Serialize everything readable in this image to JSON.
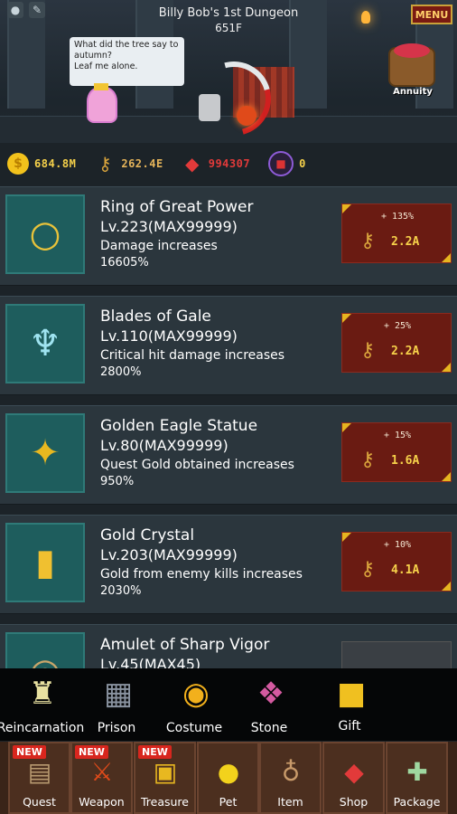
{
  "scene": {
    "title": "Billy Bob's 1st Dungeon",
    "floor": "651F",
    "menu_label": "MENU",
    "speech_lines": [
      "What did the tree say to",
      "autumn?",
      "Leaf me alone."
    ],
    "annuity_label": "Annuity",
    "top_icons": [
      "coin-pile-icon",
      "wrench-icon"
    ]
  },
  "currency": {
    "gold": "684.8M",
    "keys": "262.4E",
    "gems": "994307",
    "stones": "0"
  },
  "items": [
    {
      "name": "Ring of Great Power",
      "level": "Lv.223(MAX99999)",
      "desc": "Damage increases",
      "value": "16605%",
      "upgrade_pct": "+ 135%",
      "cost": "2.2A",
      "icon": "ring-icon"
    },
    {
      "name": "Blades of Gale",
      "level": "Lv.110(MAX99999)",
      "desc": "Critical hit damage increases",
      "value": "2800%",
      "upgrade_pct": "+ 25%",
      "cost": "2.2A",
      "icon": "blade-icon"
    },
    {
      "name": "Golden Eagle Statue",
      "level": "Lv.80(MAX99999)",
      "desc": "Quest Gold obtained increases",
      "value": "950%",
      "upgrade_pct": "+ 15%",
      "cost": "1.6A",
      "icon": "eagle-icon"
    },
    {
      "name": "Gold Crystal",
      "level": "Lv.203(MAX99999)",
      "desc": "Gold from enemy kills increases",
      "value": "2030%",
      "upgrade_pct": "+ 10%",
      "cost": "4.1A",
      "icon": "crystal-icon"
    },
    {
      "name": "Amulet of Sharp Vigor",
      "level": "Lv.45(MAX45)",
      "icon": "amulet-icon"
    }
  ],
  "mid_menu": [
    {
      "label": "Reincarnation",
      "icon": "reincarnation-icon"
    },
    {
      "label": "Prison",
      "icon": "prison-icon"
    },
    {
      "label": "Costume",
      "icon": "costume-icon"
    },
    {
      "label": "Stone",
      "icon": "stone-basket-icon"
    },
    {
      "label": "Gift",
      "icon": "gift-icon"
    }
  ],
  "bottom_tabs": [
    {
      "label": "Quest",
      "new": "NEW",
      "icon": "scroll-icon"
    },
    {
      "label": "Weapon",
      "new": "NEW",
      "icon": "sword-icon"
    },
    {
      "label": "Treasure",
      "new": "NEW",
      "icon": "treasure-chest-icon"
    },
    {
      "label": "Pet",
      "icon": "chick-icon"
    },
    {
      "label": "Item",
      "icon": "bag-icon"
    },
    {
      "label": "Shop",
      "icon": "gem-shop-icon"
    },
    {
      "label": "Package",
      "icon": "package-icon"
    }
  ],
  "colors": {
    "list_bg": "#2b363d",
    "upgrade_bg": "#6a1b12",
    "accent_gold": "#f6d14a",
    "menu_red": "#7a1a12"
  }
}
